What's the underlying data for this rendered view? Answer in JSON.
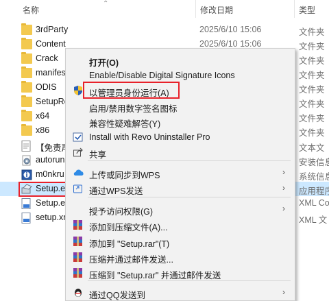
{
  "header": {
    "name": "名称",
    "date": "修改日期",
    "type": "类型",
    "sort_icon": "chevron-up-icon"
  },
  "files": [
    {
      "name": "3rdParty",
      "date": "2025/6/10 15:06",
      "type": "文件夹",
      "icon": "folder"
    },
    {
      "name": "Content",
      "date": "2025/6/10 15:06",
      "type": "文件夹",
      "icon": "folder"
    },
    {
      "name": "Crack",
      "date": "",
      "type": "文件夹",
      "icon": "folder"
    },
    {
      "name": "manifes",
      "date": "",
      "type": "文件夹",
      "icon": "folder"
    },
    {
      "name": "ODIS",
      "date": "",
      "type": "文件夹",
      "icon": "folder"
    },
    {
      "name": "SetupRe",
      "date": "",
      "type": "文件夹",
      "icon": "folder"
    },
    {
      "name": "x64",
      "date": "",
      "type": "文件夹",
      "icon": "folder"
    },
    {
      "name": "x86",
      "date": "",
      "type": "文件夹",
      "icon": "folder"
    },
    {
      "name": "【免责声",
      "date": "",
      "type": "文本文",
      "icon": "text"
    },
    {
      "name": "autorun",
      "date": "",
      "type": "安装信息",
      "icon": "gear"
    },
    {
      "name": "m0nkru",
      "date": "",
      "type": "系统信息",
      "icon": "info"
    },
    {
      "name": "Setup.e",
      "date": "",
      "type": "应用程序",
      "icon": "setup",
      "selected": true
    },
    {
      "name": "Setup.e",
      "date": "",
      "type": "XML Co",
      "icon": "xml"
    },
    {
      "name": "setup.xr",
      "date": "",
      "type": "XML 文",
      "icon": "xml"
    }
  ],
  "context_menu": {
    "items": [
      {
        "label": "打开(O)",
        "bold": true,
        "icon": ""
      },
      {
        "label": "Enable/Disable Digital Signature Icons",
        "icon": ""
      },
      {
        "label": "以管理员身份运行(A)",
        "icon": "shield-icon",
        "highlight": true
      },
      {
        "label": "启用/禁用数字签名图标",
        "icon": ""
      },
      {
        "label": "兼容性疑难解答(Y)",
        "icon": ""
      },
      {
        "label": "Install with Revo Uninstaller Pro",
        "icon": "revo-icon"
      },
      {
        "label": "共享",
        "icon": "share-icon"
      },
      {
        "label": "上传或同步到WPS",
        "icon": "wps-cloud-icon",
        "submenu": true
      },
      {
        "label": "通过WPS发送",
        "icon": "wps-send-icon",
        "submenu": true
      },
      {
        "label": "授予访问权限(G)",
        "icon": "",
        "submenu": true
      },
      {
        "label": "添加到压缩文件(A)...",
        "icon": "winrar-icon"
      },
      {
        "label": "添加到 \"Setup.rar\"(T)",
        "icon": "winrar-icon"
      },
      {
        "label": "压缩并通过邮件发送...",
        "icon": "winrar-icon"
      },
      {
        "label": "压缩到 \"Setup.rar\" 并通过邮件发送",
        "icon": "winrar-icon"
      },
      {
        "label": "通过QQ发送到",
        "icon": "qq-icon",
        "submenu": true
      }
    ],
    "submenu_arrow": "›"
  },
  "colors": {
    "selection": "#cce8ff",
    "highlight_border": "#e8212a",
    "folder": "#f3c94f",
    "menu_bg": "#f2f2f2"
  }
}
